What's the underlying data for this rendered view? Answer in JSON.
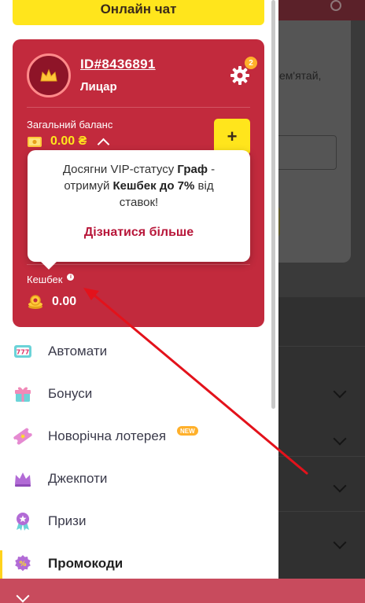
{
  "header": {
    "online_chat": "Онлайн чат"
  },
  "background": {
    "partial_text": "ем'ятай,"
  },
  "profile": {
    "user_id": "ID#8436891",
    "rank": "Лицар",
    "notifications_count": "2",
    "balance_label": "Загальний баланс",
    "balance_amount": "0.00 ₴",
    "deposit_symbol": "+",
    "cashback_label": "Кешбек",
    "cashback_amount": "0.00"
  },
  "tooltip": {
    "line1": "Досягни VIP-статусу ",
    "status": "Граф",
    "line1_end": " -",
    "line2": "отримуй ",
    "cashback_text": "Кешбек до 7%",
    "line2_end": " від",
    "line3": "ставок!",
    "link": "Дізнатися більше"
  },
  "menu": {
    "items": [
      {
        "label": "Автомати",
        "icon": "slots-777-icon"
      },
      {
        "label": "Бонуси",
        "icon": "gift-icon"
      },
      {
        "label": "Новорічна лотерея",
        "icon": "ticket-icon",
        "badge": "NEW"
      },
      {
        "label": "Джекпоти",
        "icon": "crown-icon"
      },
      {
        "label": "Призи",
        "icon": "medal-icon"
      },
      {
        "label": "Промокоди",
        "icon": "promo-percent-icon",
        "active": true
      }
    ]
  },
  "colors": {
    "brand_red": "#c22a3d",
    "accent_yellow": "#ffe51c",
    "link_red": "#b8173a",
    "annotation_arrow": "#e3121b"
  }
}
